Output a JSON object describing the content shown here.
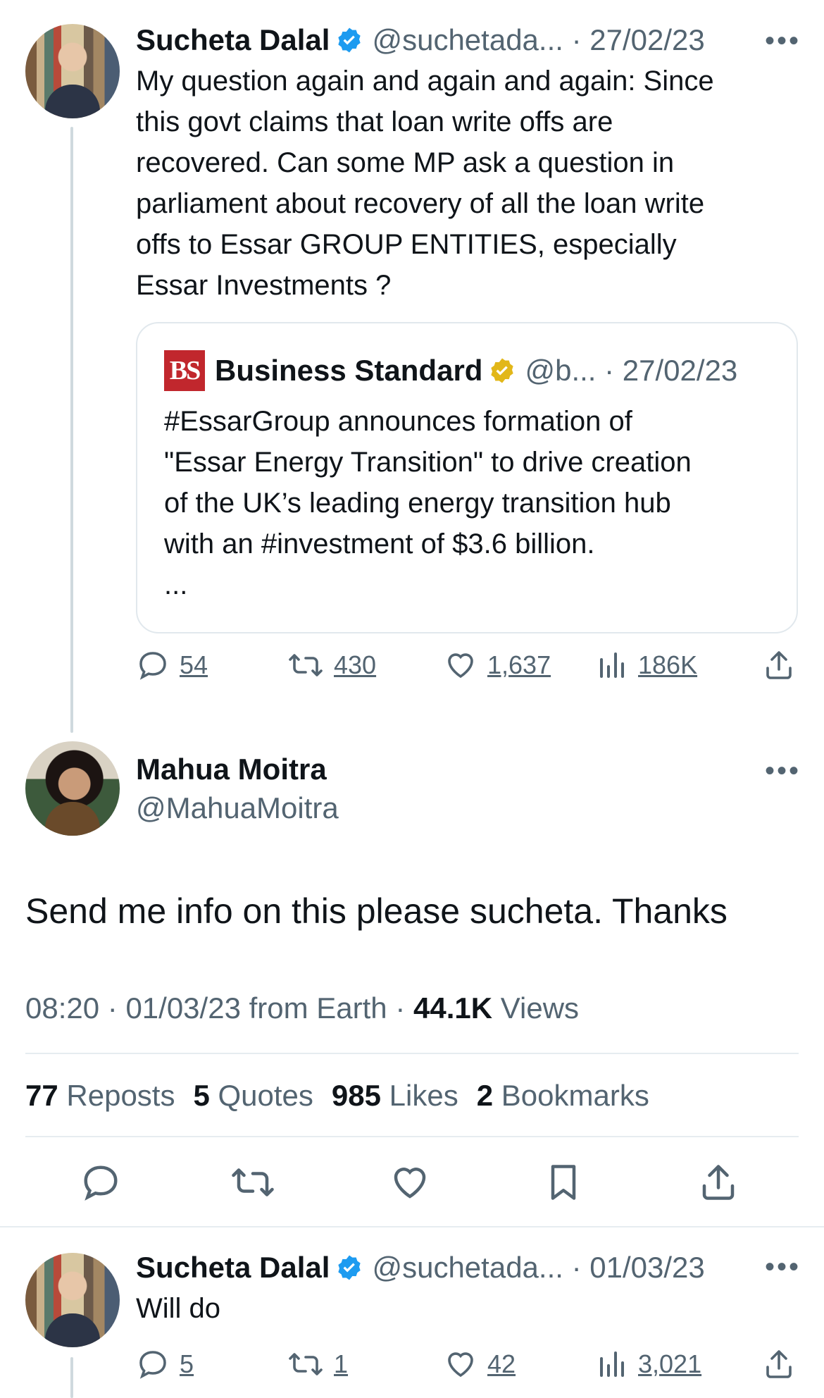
{
  "tweet1": {
    "name": "Sucheta Dalal",
    "handle": "@suchetada...",
    "date": "27/02/23",
    "more": "•••",
    "lines": [
      "My question again and again and again:  Since",
      "this govt claims that loan write offs are",
      "recovered. Can some MP ask a question in",
      "parliament about recovery of all the loan write",
      "offs  to Essar GROUP ENTITIES, especially",
      "Essar Investments ?"
    ],
    "quote": {
      "logo": "BS",
      "name": "Business Standard",
      "handle": "@b...",
      "date": "27/02/23",
      "lines": [
        "#EssarGroup announces formation of",
        "\"Essar Energy Transition\" to drive creation",
        "of the UK’s leading energy transition hub",
        "with an #investment of $3.6 billion."
      ],
      "ellipsis": "..."
    },
    "replies": "54",
    "reposts": "430",
    "likes": "1,637",
    "views": "186K"
  },
  "main_tweet": {
    "name": "Mahua Moitra",
    "handle": "@MahuaMoitra",
    "more": "•••",
    "text": "Send me info on this please sucheta. Thanks",
    "time": "08:20",
    "date": "01/03/23",
    "source": "from Earth",
    "views_count": "44.1K",
    "views_label": "Views",
    "reposts_count": "77",
    "reposts_label": "Reposts",
    "quotes_count": "5",
    "quotes_label": "Quotes",
    "likes_count": "985",
    "likes_label": "Likes",
    "bookmarks_count": "2",
    "bookmarks_label": "Bookmarks"
  },
  "tweet3": {
    "name": "Sucheta Dalal",
    "handle": "@suchetada...",
    "date": "01/03/23",
    "more": "•••",
    "text": "Will do",
    "replies": "5",
    "reposts": "1",
    "likes": "42",
    "views": "3,021"
  },
  "colors": {
    "verified_blue": "#1d9bf0",
    "verified_gold": "#e2b719",
    "bs_red": "#c1272d",
    "muted": "#536471"
  }
}
